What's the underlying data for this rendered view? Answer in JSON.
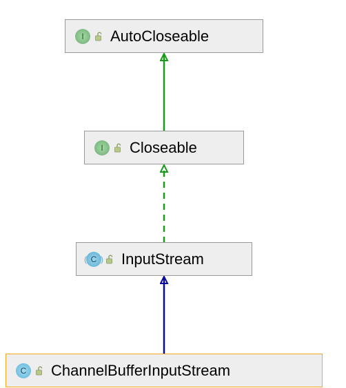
{
  "nodes": {
    "autoCloseable": {
      "label": "AutoCloseable",
      "badge": "I",
      "kind": "interface"
    },
    "closeable": {
      "label": "Closeable",
      "badge": "I",
      "kind": "interface"
    },
    "inputStream": {
      "label": "InputStream",
      "badge": "C",
      "kind": "class-abstract"
    },
    "channelBufferInputStream": {
      "label": "ChannelBufferInputStream",
      "badge": "C",
      "kind": "class"
    }
  },
  "chart_data": {
    "type": "diagram",
    "title": "",
    "nodes": [
      {
        "id": "AutoCloseable",
        "kind": "interface"
      },
      {
        "id": "Closeable",
        "kind": "interface"
      },
      {
        "id": "InputStream",
        "kind": "abstract-class"
      },
      {
        "id": "ChannelBufferInputStream",
        "kind": "class",
        "highlighted": true
      }
    ],
    "edges": [
      {
        "from": "Closeable",
        "to": "AutoCloseable",
        "relation": "extends-interface",
        "style": "solid-green"
      },
      {
        "from": "InputStream",
        "to": "Closeable",
        "relation": "implements",
        "style": "dashed-green"
      },
      {
        "from": "ChannelBufferInputStream",
        "to": "InputStream",
        "relation": "extends-class",
        "style": "solid-blue"
      }
    ]
  }
}
